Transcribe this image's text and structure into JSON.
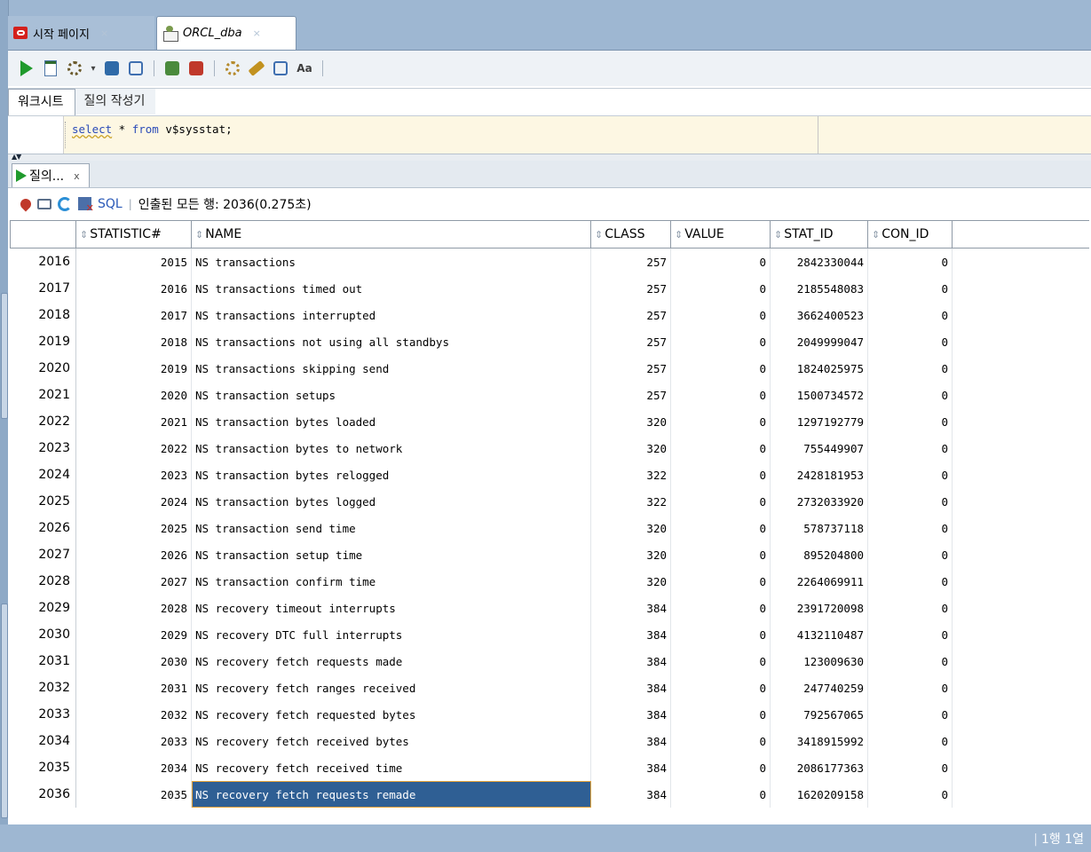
{
  "tabs": [
    {
      "label": "시작 페이지",
      "icon": "oracle-icon",
      "active": false
    },
    {
      "label": "ORCL_dba",
      "icon": "database-connection-icon",
      "active": true
    }
  ],
  "tab_close_glyph": "×",
  "worksheet_tabs": {
    "worksheet": "워크시트",
    "query_builder": "질의 작성기"
  },
  "sql": {
    "keyword1": "select",
    "star": " * ",
    "keyword2": "from",
    "rest": " v$sysstat;"
  },
  "result_tab": {
    "label": "질의...",
    "close": "x"
  },
  "result_toolbar": {
    "sql_link": "SQL",
    "separator": "|",
    "status": "인출된 모든 행: 2036(0.275초)"
  },
  "columns": [
    "STATISTIC#",
    "NAME",
    "CLASS",
    "VALUE",
    "STAT_ID",
    "CON_ID"
  ],
  "rows": [
    {
      "rn": "2016",
      "stat": "2015",
      "name": "NS transactions",
      "cls": "257",
      "val": "0",
      "id": "2842330044",
      "con": "0"
    },
    {
      "rn": "2017",
      "stat": "2016",
      "name": "NS transactions timed out",
      "cls": "257",
      "val": "0",
      "id": "2185548083",
      "con": "0"
    },
    {
      "rn": "2018",
      "stat": "2017",
      "name": "NS transactions interrupted",
      "cls": "257",
      "val": "0",
      "id": "3662400523",
      "con": "0"
    },
    {
      "rn": "2019",
      "stat": "2018",
      "name": "NS transactions not using all standbys",
      "cls": "257",
      "val": "0",
      "id": "2049999047",
      "con": "0"
    },
    {
      "rn": "2020",
      "stat": "2019",
      "name": "NS transactions skipping send",
      "cls": "257",
      "val": "0",
      "id": "1824025975",
      "con": "0"
    },
    {
      "rn": "2021",
      "stat": "2020",
      "name": "NS transaction setups",
      "cls": "257",
      "val": "0",
      "id": "1500734572",
      "con": "0"
    },
    {
      "rn": "2022",
      "stat": "2021",
      "name": "NS transaction bytes loaded",
      "cls": "320",
      "val": "0",
      "id": "1297192779",
      "con": "0"
    },
    {
      "rn": "2023",
      "stat": "2022",
      "name": "NS transaction bytes to network",
      "cls": "320",
      "val": "0",
      "id": "755449907",
      "con": "0"
    },
    {
      "rn": "2024",
      "stat": "2023",
      "name": "NS transaction bytes relogged",
      "cls": "322",
      "val": "0",
      "id": "2428181953",
      "con": "0"
    },
    {
      "rn": "2025",
      "stat": "2024",
      "name": "NS transaction bytes logged",
      "cls": "322",
      "val": "0",
      "id": "2732033920",
      "con": "0"
    },
    {
      "rn": "2026",
      "stat": "2025",
      "name": "NS transaction send time",
      "cls": "320",
      "val": "0",
      "id": "578737118",
      "con": "0"
    },
    {
      "rn": "2027",
      "stat": "2026",
      "name": "NS transaction setup time",
      "cls": "320",
      "val": "0",
      "id": "895204800",
      "con": "0"
    },
    {
      "rn": "2028",
      "stat": "2027",
      "name": "NS transaction confirm time",
      "cls": "320",
      "val": "0",
      "id": "2264069911",
      "con": "0"
    },
    {
      "rn": "2029",
      "stat": "2028",
      "name": "NS recovery timeout interrupts",
      "cls": "384",
      "val": "0",
      "id": "2391720098",
      "con": "0"
    },
    {
      "rn": "2030",
      "stat": "2029",
      "name": "NS recovery DTC full interrupts",
      "cls": "384",
      "val": "0",
      "id": "4132110487",
      "con": "0"
    },
    {
      "rn": "2031",
      "stat": "2030",
      "name": "NS recovery fetch requests made",
      "cls": "384",
      "val": "0",
      "id": "123009630",
      "con": "0"
    },
    {
      "rn": "2032",
      "stat": "2031",
      "name": "NS recovery fetch ranges received",
      "cls": "384",
      "val": "0",
      "id": "247740259",
      "con": "0"
    },
    {
      "rn": "2033",
      "stat": "2032",
      "name": "NS recovery fetch requested bytes",
      "cls": "384",
      "val": "0",
      "id": "792567065",
      "con": "0"
    },
    {
      "rn": "2034",
      "stat": "2033",
      "name": "NS recovery fetch received bytes",
      "cls": "384",
      "val": "0",
      "id": "3418915992",
      "con": "0"
    },
    {
      "rn": "2035",
      "stat": "2034",
      "name": "NS recovery fetch received time",
      "cls": "384",
      "val": "0",
      "id": "2086177363",
      "con": "0"
    },
    {
      "rn": "2036",
      "stat": "2035",
      "name": "NS recovery fetch requests remade",
      "cls": "384",
      "val": "0",
      "id": "1620209158",
      "con": "0",
      "selected": true
    }
  ],
  "status_bar": {
    "separator": "|",
    "position": "1행 1열"
  },
  "colors": {
    "selection": "#2f5f94",
    "selection_outline": "#e6a33a",
    "frame": "#9eb7d2",
    "editor_bg": "#fdf7e3",
    "keyword": "#2b4bb8"
  }
}
